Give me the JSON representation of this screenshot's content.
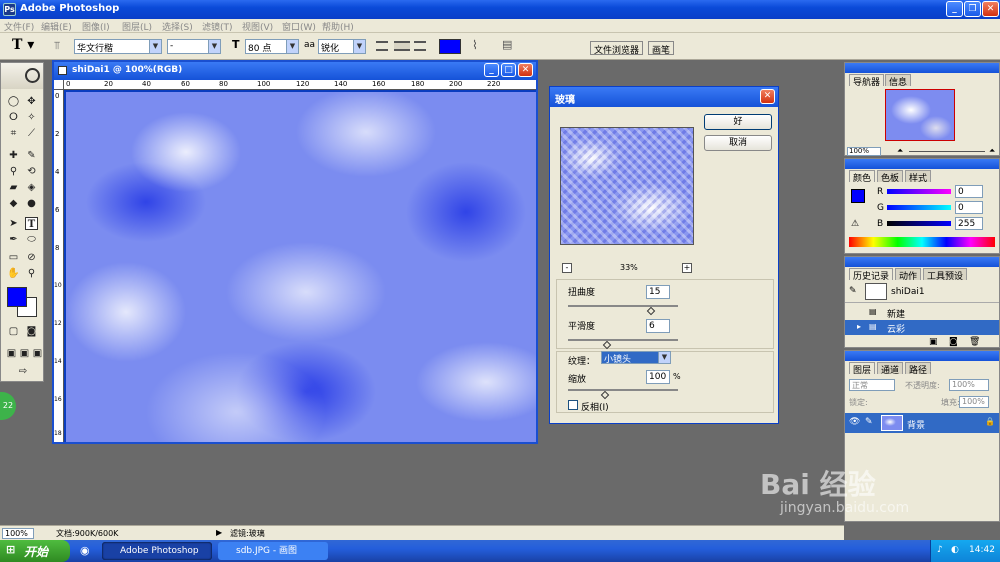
{
  "app": {
    "title": "Adobe Photoshop"
  },
  "menubar": {
    "items": [
      "文件(F)",
      "编辑(E)",
      "图像(I)",
      "图层(L)",
      "选择(S)",
      "滤镜(T)",
      "视图(V)",
      "窗口(W)",
      "帮助(H)"
    ]
  },
  "options": {
    "font_family": "华文行楷",
    "font_style": "-",
    "font_size": "80 点",
    "aa_label": "aa",
    "antialias": "锐化",
    "text_color": "#0000ff",
    "palette_tabs": [
      "文件浏览器",
      "画笔"
    ]
  },
  "document": {
    "title": "shiDai1 @ 100%(RGB)",
    "ruler_top": [
      "0",
      "20",
      "40",
      "60",
      "80",
      "100",
      "120",
      "140",
      "160",
      "180",
      "200",
      "220"
    ],
    "ruler_left": [
      "0",
      "2",
      "4",
      "6",
      "8",
      "10",
      "12",
      "14",
      "16",
      "18"
    ]
  },
  "glass_dialog": {
    "title": "玻璃",
    "ok": "好",
    "cancel": "取消",
    "zoom": "33%",
    "minus": "-",
    "plus": "+",
    "distortion_label": "扭曲度",
    "distortion_value": "15",
    "distortion_level": 0.75,
    "smoothness_label": "平滑度",
    "smoothness_value": "6",
    "smoothness_level": 0.35,
    "texture_label": "纹理：",
    "texture_value": "小镜头",
    "scaling_label": "缩放",
    "scaling_value": "100",
    "percent": "%",
    "invert_label": "反相(I)"
  },
  "navigator": {
    "tabs": [
      "导航器",
      "信息"
    ],
    "zoom": "100%"
  },
  "color": {
    "tabs": [
      "颜色",
      "色板",
      "样式"
    ],
    "r_label": "R",
    "r_value": "0",
    "g_label": "G",
    "g_value": "0",
    "b_label": "B",
    "b_value": "255"
  },
  "history": {
    "tabs": [
      "历史记录",
      "动作",
      "工具预设"
    ],
    "snapshot": "shiDai1",
    "items": [
      "新建",
      "云彩"
    ]
  },
  "layers": {
    "tabs": [
      "图层",
      "通道",
      "路径"
    ],
    "blend_mode": "正常",
    "opacity_label": "不透明度:",
    "opacity": "100%",
    "lock_label": "锁定:",
    "fill_label": "填充:",
    "fill": "100%",
    "layer_name": "背景"
  },
  "status": {
    "zoom": "100%",
    "doc_info": "文档:900K/600K",
    "filter_info": "滤镜:玻璃"
  },
  "taskbar": {
    "start": "开始",
    "tasks": [
      "Adobe Photoshop",
      "sdb.JPG - 画图"
    ],
    "time": "14:42"
  },
  "watermark": {
    "brand": "Bai 经验",
    "url": "jingyan.baidu.com"
  },
  "badge": "22"
}
